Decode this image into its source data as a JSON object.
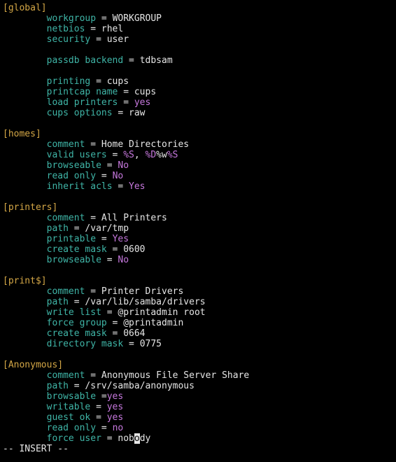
{
  "sections": {
    "global": {
      "header": "[global]",
      "workgroup_k": "workgroup",
      "workgroup_v": "WORKGROUP",
      "netbios_k": "netbios",
      "netbios_v": "rhel",
      "security_k": "security",
      "security_v": "user",
      "passdb_k": "passdb backend",
      "passdb_v": "tdbsam",
      "printing_k": "printing",
      "printing_v": "cups",
      "printcap_k": "printcap name",
      "printcap_v": "cups",
      "loadpr_k": "load printers",
      "loadpr_v": "yes",
      "cupsopt_k": "cups options",
      "cupsopt_v": "raw"
    },
    "homes": {
      "header": "[homes]",
      "comment_k": "comment",
      "comment_v": "Home Directories",
      "valid_k": "valid users",
      "valid_a": "%S",
      "valid_sep": ", ",
      "valid_b1": "%D",
      "valid_b2": "%w",
      "valid_b3": "%S",
      "browse_k": "browseable",
      "browse_v": "No",
      "ro_k": "read only",
      "ro_v": "No",
      "acls_k": "inherit acls",
      "acls_v": "Yes"
    },
    "printers": {
      "header": "[printers]",
      "comment_k": "comment",
      "comment_v": "All Printers",
      "path_k": "path",
      "path_v": "/var/tmp",
      "printable_k": "printable",
      "printable_v": "Yes",
      "cmask_k": "create mask",
      "cmask_v": "0600",
      "browse_k": "browseable",
      "browse_v": "No"
    },
    "printdollar": {
      "header": "[print$]",
      "comment_k": "comment",
      "comment_v": "Printer Drivers",
      "path_k": "path",
      "path_v": "/var/lib/samba/drivers",
      "wl_k": "write list",
      "wl_v": "@printadmin root",
      "fg_k": "force group",
      "fg_v": "@printadmin",
      "cmask_k": "create mask",
      "cmask_v": "0664",
      "dmask_k": "directory mask",
      "dmask_v": "0775"
    },
    "anon": {
      "header": "[Anonymous]",
      "comment_k": "comment",
      "comment_v": "Anonymous File Server Share",
      "path_k": "path",
      "path_v": "/srv/samba/anonymous",
      "browse_k": "browsable",
      "browse_eq": " =",
      "browse_v": "yes",
      "writable_k": "writable",
      "writable_v": "yes",
      "guest_k": "guest ok",
      "guest_v": "yes",
      "ro_k": "read only",
      "ro_v": "no",
      "fu_k": "force user",
      "fu_pre": "nob",
      "fu_cur": "o",
      "fu_post": "dy"
    }
  },
  "eq": " = ",
  "indent": "        ",
  "status": "-- INSERT --"
}
